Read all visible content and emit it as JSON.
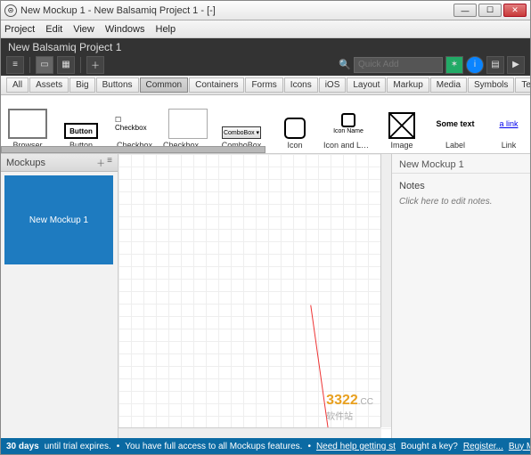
{
  "titlebar": {
    "text": "New Mockup 1 - New Balsamiq Project 1 - [-]"
  },
  "menubar": [
    "Project",
    "Edit",
    "View",
    "Windows",
    "Help"
  ],
  "darkbar": {
    "project_title": "New Balsamiq Project 1",
    "quick_add_placeholder": "Quick Add"
  },
  "categories": [
    "All",
    "Assets",
    "Big",
    "Buttons",
    "Common",
    "Containers",
    "Forms",
    "Icons",
    "iOS",
    "Layout",
    "Markup",
    "Media",
    "Symbols",
    "Text"
  ],
  "category_selected": "Common",
  "gallery": [
    {
      "label": "Browser",
      "thumb": "browser"
    },
    {
      "label": "Button",
      "thumb": "button",
      "text": "Button"
    },
    {
      "label": "Checkbox",
      "thumb": "cbx",
      "text": "☐ Checkbox"
    },
    {
      "label": "Checkbox Gr...",
      "thumb": "cbxg"
    },
    {
      "label": "ComboBox",
      "thumb": "combo",
      "text": "ComboBox ▾"
    },
    {
      "label": "Icon",
      "thumb": "icon"
    },
    {
      "label": "Icon and Label",
      "thumb": "iconlabel",
      "text": "Icon Name"
    },
    {
      "label": "Image",
      "thumb": "image"
    },
    {
      "label": "Label",
      "thumb": "sometext",
      "text": "Some text"
    },
    {
      "label": "Link",
      "thumb": "link",
      "text": "a link"
    }
  ],
  "left_panel": {
    "title": "Mockups",
    "items": [
      "New Mockup 1"
    ]
  },
  "right_panel": {
    "title": "New Mockup 1",
    "notes_label": "Notes",
    "notes_hint": "Click here to edit notes."
  },
  "statusbar": {
    "days": "30 days",
    "msg1": "until trial expires.",
    "msg2": "You have full access to all Mockups features.",
    "help": "Need help getting st",
    "bought": "Bought a key?",
    "register": "Register...",
    "buy": "Buy Mockups now!"
  },
  "watermark": {
    "logo": "3322",
    "sub": "软件站",
    "url": ".CC"
  }
}
